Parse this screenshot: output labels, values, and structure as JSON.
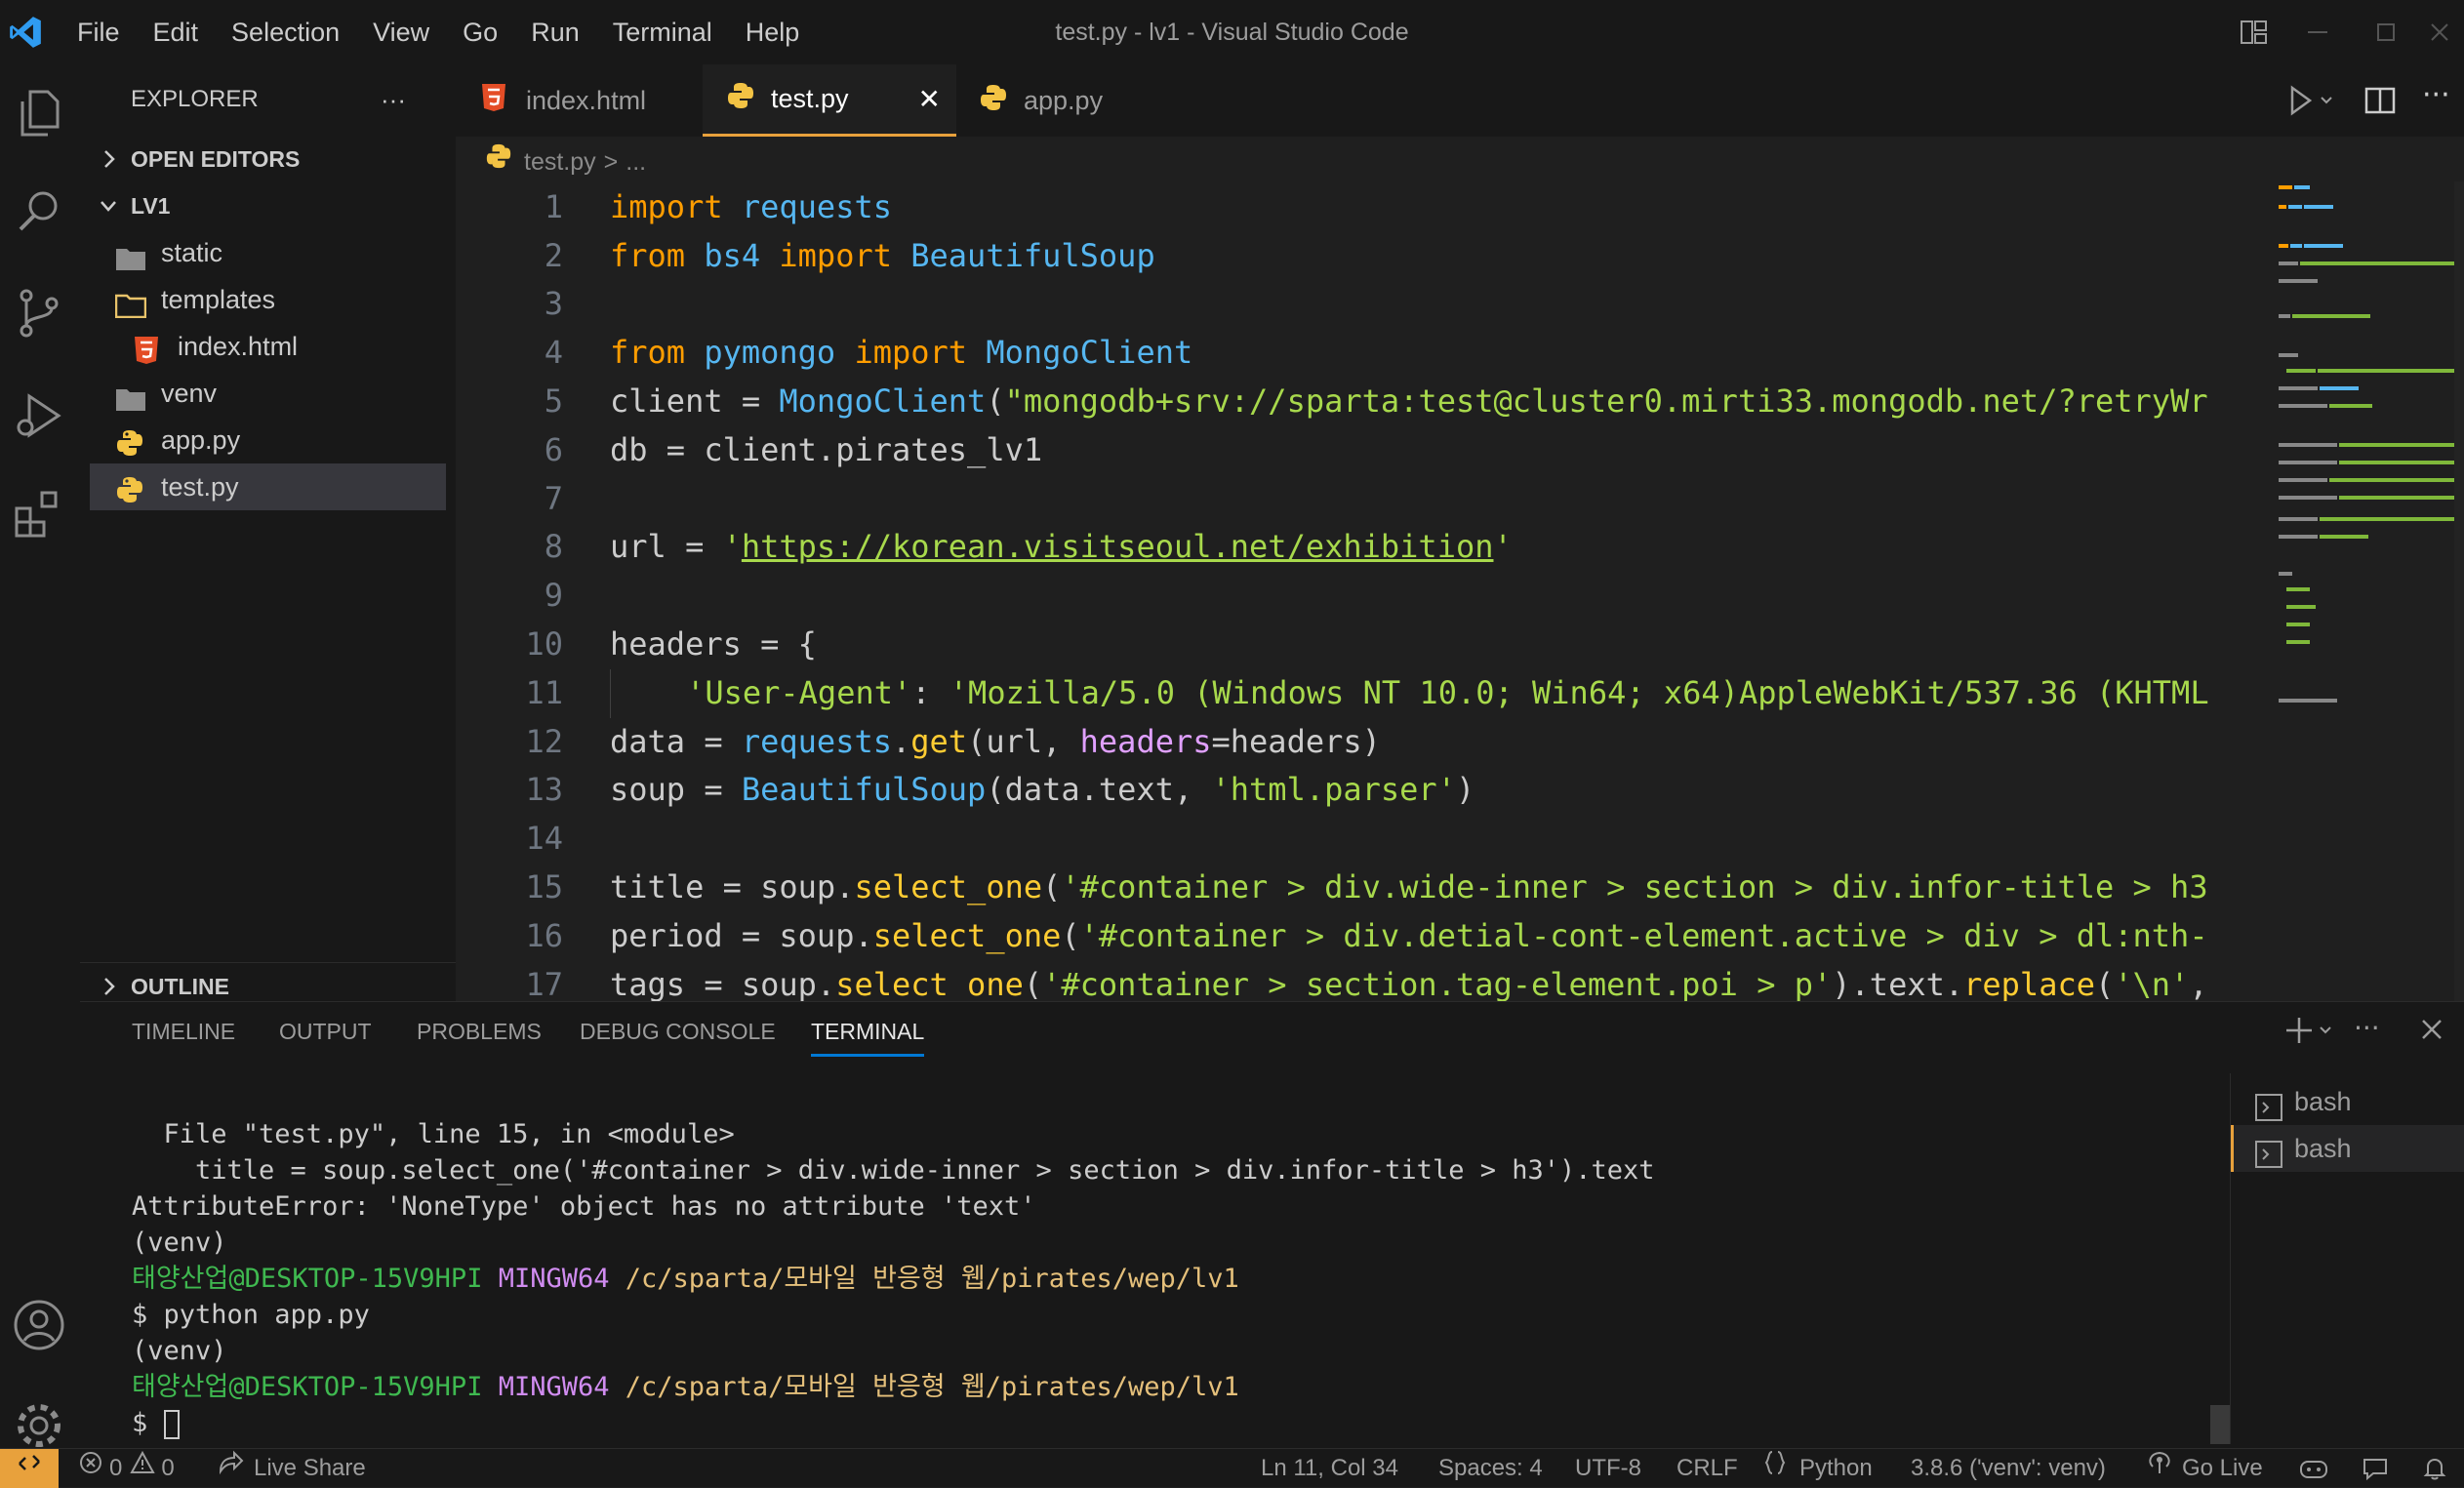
{
  "window": {
    "title": "test.py - lv1 - Visual Studio Code"
  },
  "menu": [
    "File",
    "Edit",
    "Selection",
    "View",
    "Go",
    "Run",
    "Terminal",
    "Help"
  ],
  "sidebar": {
    "title": "EXPLORER",
    "more": "···",
    "open_editors": "OPEN EDITORS",
    "root": "LV1",
    "items": [
      {
        "name": "static",
        "type": "folder"
      },
      {
        "name": "templates",
        "type": "folder-open"
      },
      {
        "name": "index.html",
        "type": "html"
      },
      {
        "name": "venv",
        "type": "folder"
      },
      {
        "name": "app.py",
        "type": "python"
      },
      {
        "name": "test.py",
        "type": "python"
      }
    ],
    "outline": "OUTLINE"
  },
  "tabs": [
    {
      "label": "index.html",
      "icon": "html-icon"
    },
    {
      "label": "test.py",
      "icon": "python-icon",
      "active": true,
      "close": "✕"
    },
    {
      "label": "app.py",
      "icon": "python-icon"
    }
  ],
  "breadcrumb": {
    "file": "test.py",
    "sep": ">",
    "rest": "..."
  },
  "code": {
    "line_numbers": [
      "1",
      "2",
      "3",
      "4",
      "5",
      "6",
      "7",
      "8",
      "9",
      "10",
      "11",
      "12",
      "13",
      "14",
      "15",
      "16",
      "17"
    ],
    "l1": [
      "import",
      " ",
      "requests"
    ],
    "l2": [
      "from",
      " ",
      "bs4",
      " ",
      "import",
      " ",
      "BeautifulSoup"
    ],
    "l4": [
      "from",
      " ",
      "pymongo",
      " ",
      "import",
      " ",
      "MongoClient"
    ],
    "l5": [
      "client = ",
      "MongoClient",
      "(",
      "\"mongodb+srv://sparta:test@cluster0.mirti33.mongodb.net/?retryWr"
    ],
    "l6": [
      "db = client.pirates_lv1"
    ],
    "l8": [
      "url = ",
      "'",
      "https://korean.visitseoul.net/exhibition",
      "'"
    ],
    "l10": [
      "headers = {"
    ],
    "l11": [
      "    ",
      "'User-Agent'",
      ": ",
      "'Mozilla/5.0 (Windows NT 10.0; Win64; x64)AppleWebKit/537.36 (KHTML"
    ],
    "l12": [
      "data = ",
      "requests",
      ".",
      "get",
      "(url, ",
      "headers",
      "=headers)"
    ],
    "l13": [
      "soup = ",
      "BeautifulSoup",
      "(data.text, ",
      "'html.parser'",
      ")"
    ],
    "l15": [
      "title = soup.",
      "select_one",
      "(",
      "'#container > div.wide-inner > section > div.infor-title > h3"
    ],
    "l16": [
      "period = soup.",
      "select_one",
      "(",
      "'#container > div.detial-cont-element.active > div > dl:nth-"
    ],
    "l17": [
      "tags = soup.",
      "select_one",
      "(",
      "'#container > section.tag-element.poi > p'",
      ").text.",
      "replace",
      "(",
      "'\\n'",
      ","
    ]
  },
  "panel": {
    "tabs": [
      "TIMELINE",
      "OUTPUT",
      "PROBLEMS",
      "DEBUG CONSOLE",
      "TERMINAL"
    ],
    "active": "TERMINAL",
    "terminal": {
      "t1": "  File \"test.py\", line 15, in <module>",
      "t2": "    title = soup.select_one('#container > div.wide-inner > section > div.infor-title > h3').text",
      "t3": "AttributeError: 'NoneType' object has no attribute 'text'",
      "t4": "(venv)",
      "t5_user": "태양산업@DESKTOP-15V9HPI",
      "t5_env": "MINGW64",
      "t5_path": "/c/sparta/모바일 반응형 웹/pirates/wep/lv1",
      "t6": "$ python app.py",
      "t7": "(venv)",
      "t8_user": "태양산업@DESKTOP-15V9HPI",
      "t8_env": "MINGW64",
      "t8_path": "/c/sparta/모바일 반응형 웹/pirates/wep/lv1",
      "t9": "$ "
    },
    "instances": [
      "bash",
      "bash"
    ]
  },
  "status": {
    "errors": "0",
    "warnings": "0",
    "live_share": "Live Share",
    "position": "Ln 11, Col 34",
    "spaces": "Spaces: 4",
    "encoding": "UTF-8",
    "eol": "CRLF",
    "language": "Python",
    "interpreter": "3.8.6 ('venv': venv)",
    "go_live": "Go Live"
  },
  "colors": {
    "accent": "#0078d4",
    "keyword": "#ff9d00",
    "module": "#56b6f0",
    "string": "#a8d94c",
    "function": "#ffcc33"
  }
}
